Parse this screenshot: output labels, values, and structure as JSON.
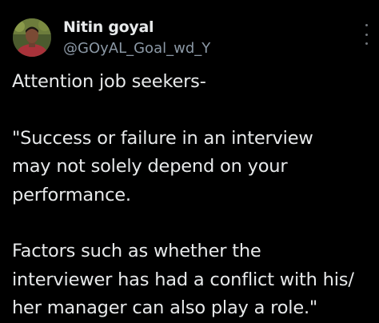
{
  "author": {
    "display_name": "Nitin goyal",
    "handle": "@GOyAL_Goal_wd_Y",
    "avatar_icon": "profile-photo"
  },
  "menu": {
    "more_icon": "more-options-icon"
  },
  "tweet": {
    "lines": [
      "Attention job seekers-",
      "\"Success or failure in an interview",
      "may not solely depend on your",
      "performance.",
      "Factors such as whether the",
      "interviewer has had a conflict with his/",
      "her manager can also play a role.\""
    ]
  },
  "colors": {
    "background": "#000000",
    "primary_text": "#e7e9ea",
    "secondary_text": "#8b98a5"
  }
}
